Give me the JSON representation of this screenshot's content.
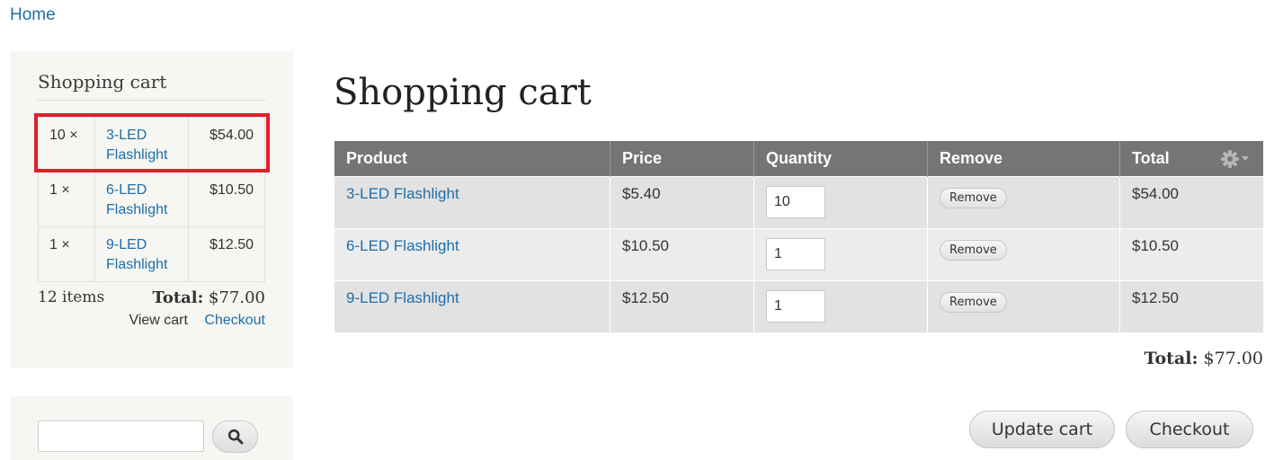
{
  "breadcrumb": {
    "home": "Home"
  },
  "sidebar_cart": {
    "title": "Shopping cart",
    "items": [
      {
        "qty": "10 ×",
        "title_line1": "3-LED",
        "title_line2": "Flashlight",
        "price": "$54.00"
      },
      {
        "qty": "1 ×",
        "title_line1": "6-LED",
        "title_line2": "Flashlight",
        "price": "$10.50"
      },
      {
        "qty": "1 ×",
        "title_line1": "9-LED",
        "title_line2": "Flashlight",
        "price": "$12.50"
      }
    ],
    "item_count": "12 items",
    "total_label": "Total:",
    "total_value": "$77.00",
    "view_cart": "View cart",
    "checkout": "Checkout"
  },
  "search": {
    "value": ""
  },
  "main": {
    "title": "Shopping cart",
    "columns": {
      "product": "Product",
      "price": "Price",
      "quantity": "Quantity",
      "remove": "Remove",
      "total": "Total"
    },
    "rows": [
      {
        "product": "3-LED Flashlight",
        "price": "$5.40",
        "quantity": "10",
        "remove": "Remove",
        "total": "$54.00"
      },
      {
        "product": "6-LED Flashlight",
        "price": "$10.50",
        "quantity": "1",
        "remove": "Remove",
        "total": "$10.50"
      },
      {
        "product": "9-LED Flashlight",
        "price": "$12.50",
        "quantity": "1",
        "remove": "Remove",
        "total": "$12.50"
      }
    ],
    "total_label": "Total:",
    "total_value": "$77.00",
    "update_cart": "Update cart",
    "checkout": "Checkout"
  },
  "colors": {
    "link": "#1f6ea8",
    "header_bg": "#757575",
    "highlight": "#e0202a",
    "block_bg": "#f6f6f2"
  },
  "icons": {
    "search": "search-icon",
    "gear": "gear-icon"
  }
}
